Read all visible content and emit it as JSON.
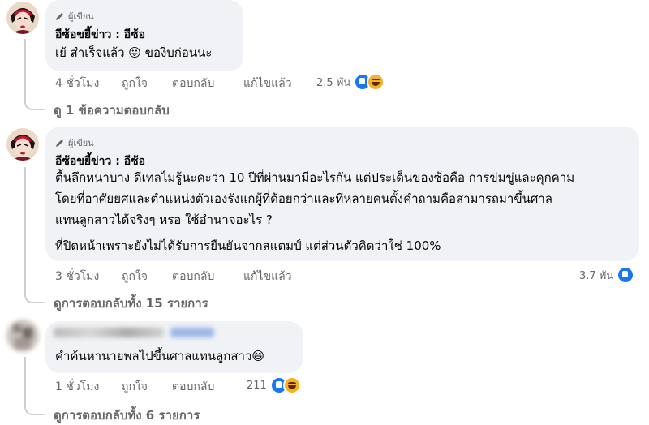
{
  "comments": [
    {
      "badge": "ผู้เขียน",
      "author": "อีซ้อขยี้ข่าว : อีซ้อ",
      "lines": [
        "เย้ สำเร็จแล้ว 😛 ของีบก่อนนะ"
      ],
      "time": "4 ชั่วโมง",
      "like": "ถูกใจ",
      "reply": "ตอบกลับ",
      "edited": "แก้ไขแล้ว",
      "reaction_count": "2.5 พัน",
      "view_replies": "ดู 1 ข้อความตอบกลับ"
    },
    {
      "badge": "ผู้เขียน",
      "author": "อีซ้อขยี้ข่าว : อีซ้อ",
      "lines": [
        "ตื้นลึกหนาบาง ดีเทลไม่รู้นะคะว่า 10 ปีที่ผ่านมามีอะไรกัน แต่ประเด็นของซ้อคือ การข่มขู่และคุกคาม",
        "โดยที่อาศัยยศและตำแหน่งตัวเองรังแกผู้ที่ด้อยกว่าและที่หลายคนตั้งคำถามคือสามารถมาขึ้นศาล",
        "แทนลูกสาวได้จริงๆ หรอ ใช้อำนาจอะไร ?",
        "ที่ปิดหน้าเพราะยังไม่ได้รับการยืนยันจากสแตมป์ แต่ส่วนตัวคิดว่าใช่ 100%"
      ],
      "time": "3 ชั่วโมง",
      "like": "ถูกใจ",
      "reply": "ตอบกลับ",
      "edited": "แก้ไขแล้ว",
      "reaction_count": "3.7 พัน",
      "view_replies": "ดูการตอบกลับทั้ง 15 รายการ"
    },
    {
      "lines": [
        "คำค้นหานายพลไปขึ้นศาลแทนลูกสาว😄"
      ],
      "time": "1 ชั่วโมง",
      "like": "ถูกใจ",
      "reply": "ตอบกลับ",
      "reaction_count": "211",
      "view_replies": "ดูการตอบกลับทั้ง 6 รายการ"
    }
  ]
}
